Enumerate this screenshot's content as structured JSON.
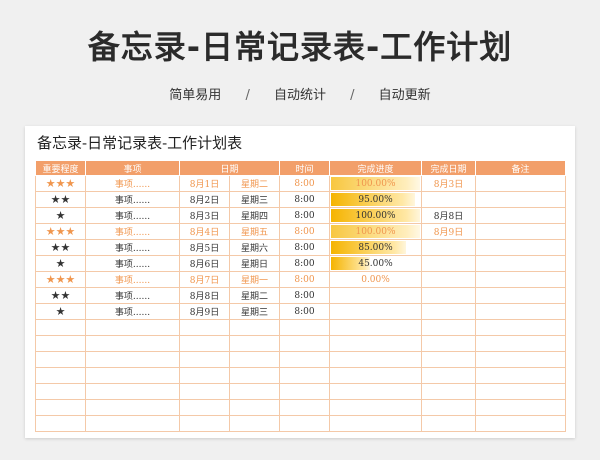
{
  "page": {
    "title": "备忘录-日常记录表-工作计划",
    "features": [
      "简单易用",
      "自动统计",
      "自动更新"
    ],
    "separator": "/"
  },
  "sheet": {
    "title": "备忘录-日常记录表-工作计划表",
    "headers": [
      "重要程度",
      "事项",
      "日期",
      "",
      "时间",
      "完成进度",
      "完成日期",
      "备注"
    ],
    "rows": [
      {
        "stars": "★★★",
        "item": "事项......",
        "date": "8月1日",
        "weekday": "星期二",
        "time": "8:00",
        "progress": "100.00%",
        "progress_value": 1.0,
        "done_date": "8月3日",
        "note": "",
        "style": "orange"
      },
      {
        "stars": "★★",
        "item": "事项......",
        "date": "8月2日",
        "weekday": "星期三",
        "time": "8:00",
        "progress": "95.00%",
        "progress_value": 0.95,
        "done_date": "",
        "note": "",
        "style": "normal"
      },
      {
        "stars": "★",
        "item": "事项......",
        "date": "8月3日",
        "weekday": "星期四",
        "time": "8:00",
        "progress": "100.00%",
        "progress_value": 1.0,
        "done_date": "8月8日",
        "note": "",
        "style": "normal"
      },
      {
        "stars": "★★★",
        "item": "事项......",
        "date": "8月4日",
        "weekday": "星期五",
        "time": "8:00",
        "progress": "100.00%",
        "progress_value": 1.0,
        "done_date": "8月9日",
        "note": "",
        "style": "orange"
      },
      {
        "stars": "★★",
        "item": "事项......",
        "date": "8月5日",
        "weekday": "星期六",
        "time": "8:00",
        "progress": "85.00%",
        "progress_value": 0.85,
        "done_date": "",
        "note": "",
        "style": "normal"
      },
      {
        "stars": "★",
        "item": "事项......",
        "date": "8月6日",
        "weekday": "星期日",
        "time": "8:00",
        "progress": "45.00%",
        "progress_value": 0.45,
        "done_date": "",
        "note": "",
        "style": "normal"
      },
      {
        "stars": "★★★",
        "item": "事项......",
        "date": "8月7日",
        "weekday": "星期一",
        "time": "8:00",
        "progress": "0.00%",
        "progress_value": 0.0,
        "done_date": "",
        "note": "",
        "style": "orange"
      },
      {
        "stars": "★★",
        "item": "事项......",
        "date": "8月8日",
        "weekday": "星期二",
        "time": "8:00",
        "progress": "",
        "progress_value": null,
        "done_date": "",
        "note": "",
        "style": "normal"
      },
      {
        "stars": "★",
        "item": "事项......",
        "date": "8月9日",
        "weekday": "星期三",
        "time": "8:00",
        "progress": "",
        "progress_value": null,
        "done_date": "",
        "note": "",
        "style": "normal"
      }
    ],
    "empty_rows": 7
  },
  "colors": {
    "header_bg": "#f29f6a",
    "accent_text": "#f0964e",
    "grid": "#f4c9a8",
    "progress_bar": "#f5b400"
  }
}
